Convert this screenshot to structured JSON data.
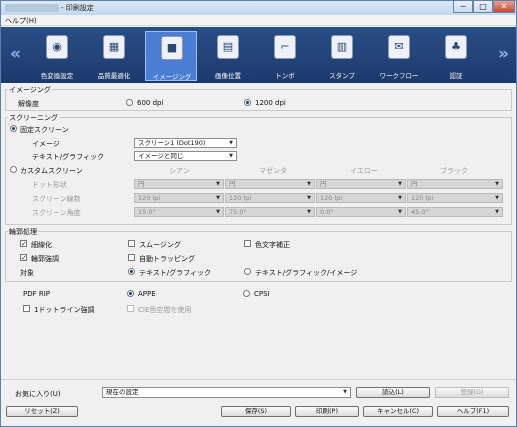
{
  "window": {
    "title": "- 印刷設定",
    "min_glyph": "─",
    "max_glyph": "□",
    "close_glyph": "✕"
  },
  "menu": {
    "help": "ヘルプ(H)"
  },
  "toolbar": {
    "prev_glyph": "«",
    "next_glyph": "»",
    "items": [
      {
        "label": "色変換設定",
        "icon": "color-conversion-icon",
        "glyph": "◉"
      },
      {
        "label": "品質最適化",
        "icon": "quality-optimize-icon",
        "glyph": "▦"
      },
      {
        "label": "イメージング",
        "icon": "imaging-icon",
        "glyph": "■"
      },
      {
        "label": "画像位置",
        "icon": "image-position-icon",
        "glyph": "▤"
      },
      {
        "label": "トンボ",
        "icon": "crop-marks-icon",
        "glyph": "⌐"
      },
      {
        "label": "スタンプ",
        "icon": "stamp-icon",
        "glyph": "▥"
      },
      {
        "label": "ワークフロー",
        "icon": "workflow-icon",
        "glyph": "✉"
      },
      {
        "label": "認証",
        "icon": "authentication-icon",
        "glyph": "♣"
      }
    ],
    "active_index": 2
  },
  "imaging": {
    "group_label": "イメージング",
    "resolution_label": "解像度",
    "res_600": "600 dpi",
    "res_1200": "1200 dpi",
    "selected": "1200 dpi"
  },
  "screening": {
    "group_label": "スクリーニング",
    "fixed_label": "固定スクリーン",
    "image_label": "イメージ",
    "image_value": "スクリーン1 (Dot190)",
    "text_label": "テキスト/グラフィック",
    "text_value": "イメージと同じ",
    "custom_label": "カスタムスクリーン",
    "columns": [
      "シアン",
      "マゼンタ",
      "イエロー",
      "ブラック"
    ],
    "rows": [
      {
        "label": "ドット形状",
        "values": [
          "円",
          "円",
          "円",
          "円"
        ]
      },
      {
        "label": "スクリーン線数",
        "values": [
          "120 lpi",
          "120 lpi",
          "120 lpi",
          "120 lpi"
        ]
      },
      {
        "label": "スクリーン角度",
        "values": [
          "15.0°",
          "75.0°",
          "0.0°",
          "45.0°"
        ]
      }
    ]
  },
  "edge": {
    "group_label": "輪郭処理",
    "thinning": "細線化",
    "smoothing": "スムージング",
    "char_correction": "色文字補正",
    "edge_enhance": "輪郭強調",
    "auto_trapping": "自動トラッピング",
    "target_label": "対象",
    "target_text": "テキスト/グラフィック",
    "target_all": "テキスト/グラフィック/イメージ",
    "checked_glyph": "✓"
  },
  "pdf": {
    "label": "PDF RIP",
    "appe": "APPE",
    "cpsi": "CPSI",
    "one_dot_line": "1ドットライン強調",
    "cie_color": "CIE色空間を使用"
  },
  "footer": {
    "favorites_label": "お気に入り(U)",
    "favorites_value": "現在の設定",
    "load": "読込(L)",
    "register": "登録(G)",
    "reset": "リセット(Z)",
    "save": "保存(S)",
    "print": "印刷(P)",
    "cancel": "キャンセル(C)",
    "help": "ヘルプ(F1)"
  },
  "dropdown_glyph": "▼"
}
